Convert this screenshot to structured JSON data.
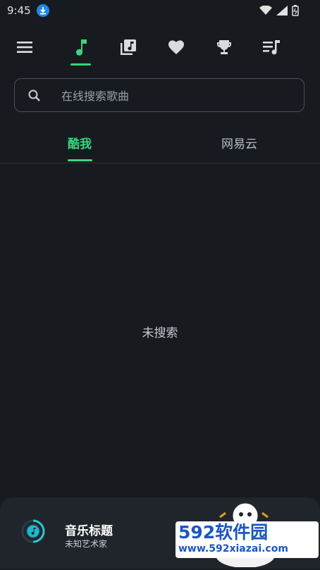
{
  "status_bar": {
    "time": "9:45"
  },
  "nav": {
    "items": [
      {
        "icon": "music-note-icon",
        "active": true
      },
      {
        "icon": "album-icon",
        "active": false
      },
      {
        "icon": "heart-icon",
        "active": false
      },
      {
        "icon": "trophy-icon",
        "active": false
      },
      {
        "icon": "playlist-icon",
        "active": false
      }
    ],
    "accent": "#3dd37c"
  },
  "search": {
    "placeholder": "在线搜索歌曲",
    "value": ""
  },
  "tabs": [
    {
      "label": "酷我",
      "active": true
    },
    {
      "label": "网易云",
      "active": false
    }
  ],
  "empty_state": {
    "text": "未搜索"
  },
  "player": {
    "title": "音乐标题",
    "artist": "未知艺术家"
  },
  "watermark": {
    "brand": "592软件园",
    "url": "www.592xiazai.com"
  }
}
